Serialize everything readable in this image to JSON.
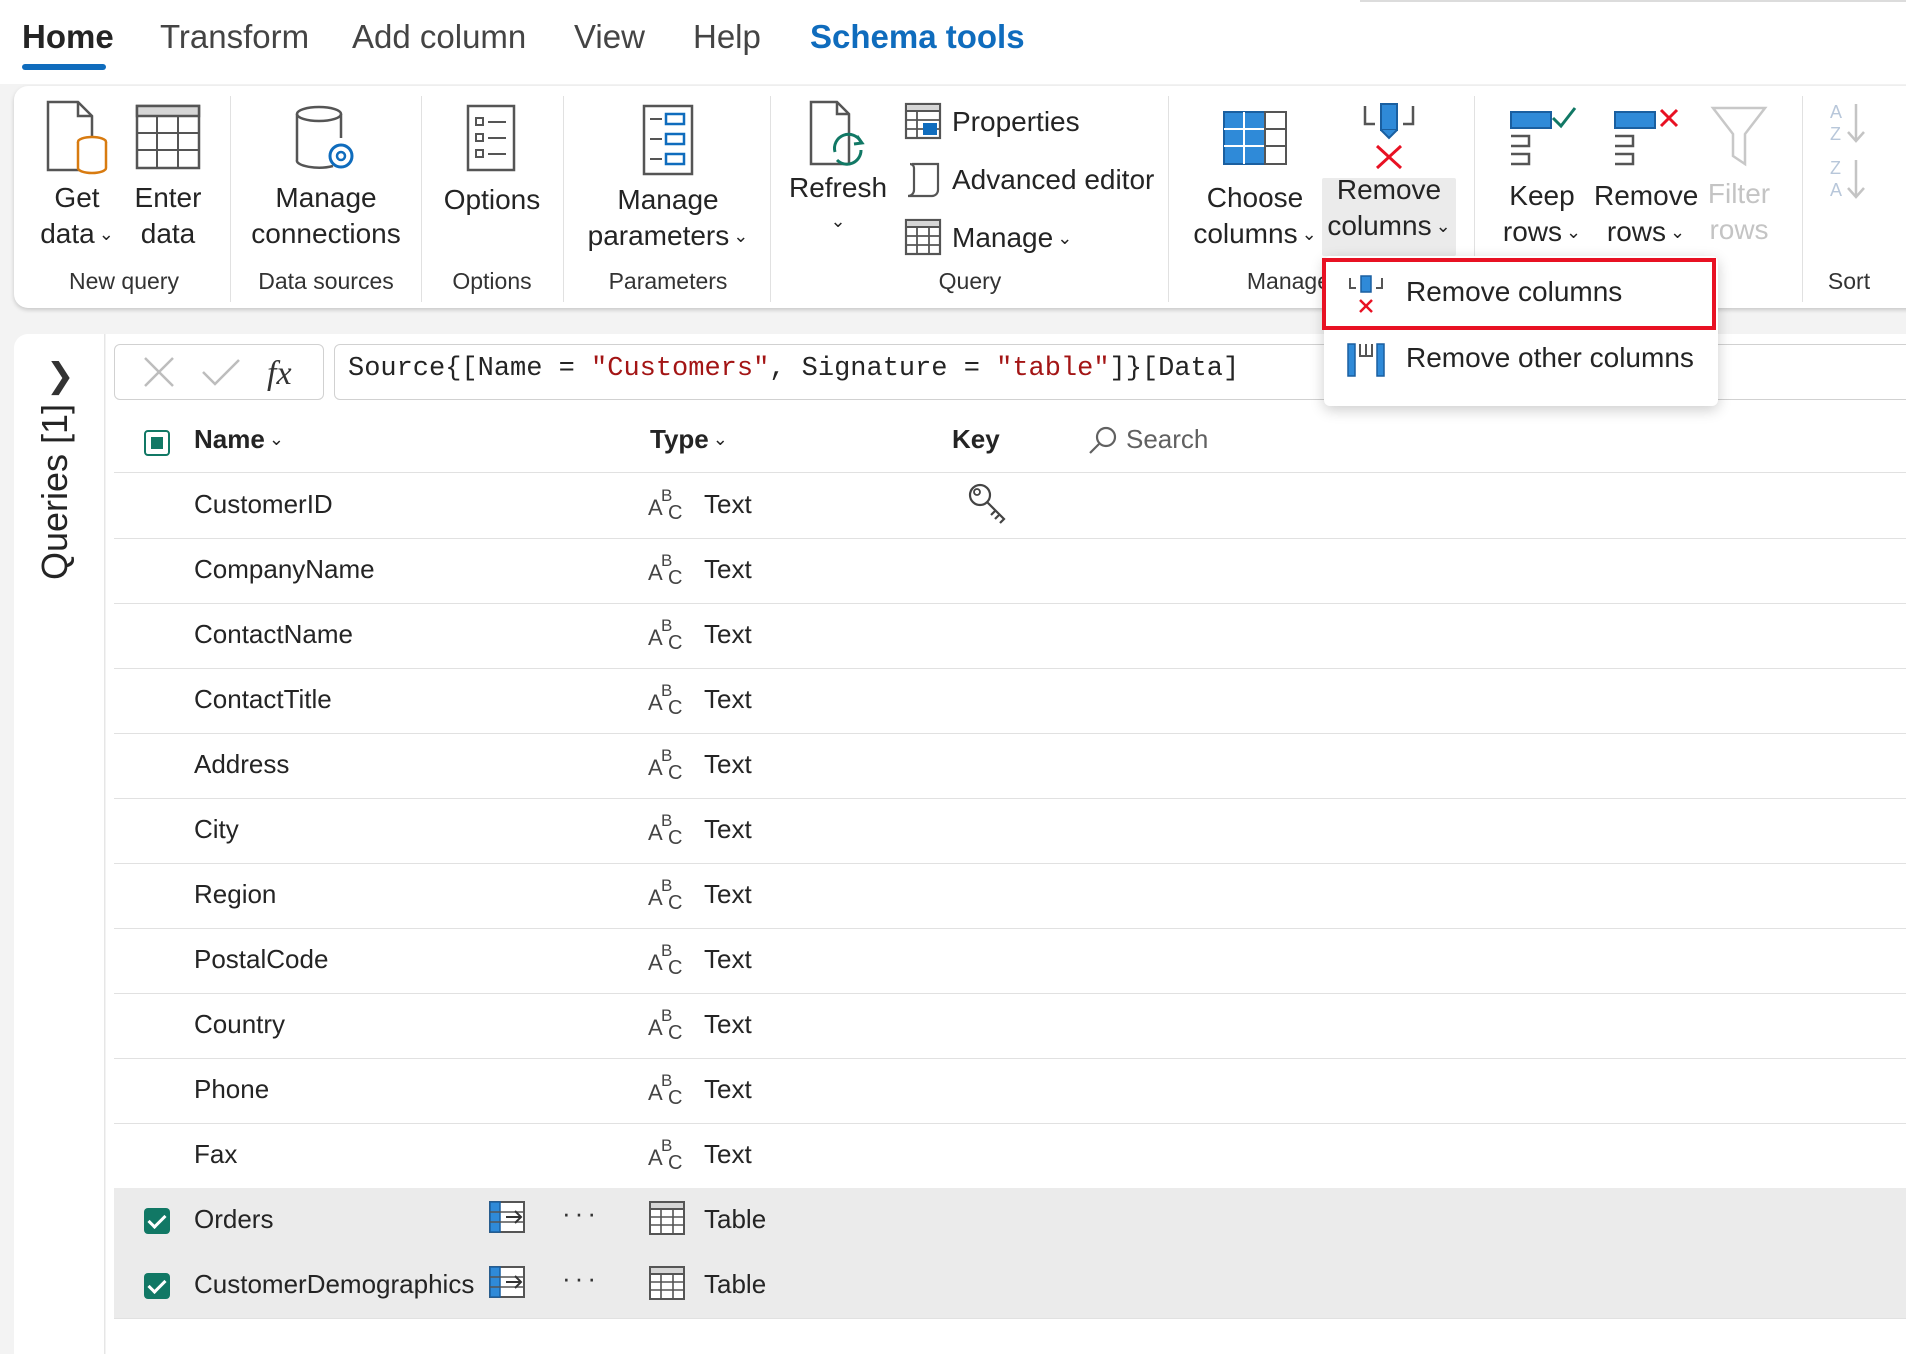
{
  "tabs": {
    "home": "Home",
    "transform": "Transform",
    "add_column": "Add column",
    "view": "View",
    "help": "Help",
    "schema_tools": "Schema tools"
  },
  "ribbon": {
    "get_data": [
      "Get",
      "data"
    ],
    "enter_data": [
      "Enter",
      "data"
    ],
    "group_new_query": "New query",
    "manage_connections": [
      "Manage",
      "connections"
    ],
    "group_data_sources": "Data sources",
    "options": "Options",
    "group_options": "Options",
    "manage_parameters": [
      "Manage",
      "parameters"
    ],
    "group_parameters": "Parameters",
    "refresh": "Refresh",
    "properties": "Properties",
    "advanced_editor": "Advanced editor",
    "manage": "Manage",
    "group_query": "Query",
    "choose_columns": [
      "Choose",
      "columns"
    ],
    "remove_columns": [
      "Remove",
      "columns"
    ],
    "group_manage": "Manage",
    "keep_rows": [
      "Keep",
      "rows"
    ],
    "remove_rows": [
      "Remove",
      "rows"
    ],
    "filter_rows": [
      "Filter",
      "rows"
    ],
    "group_sort": "Sort"
  },
  "dropdown": {
    "remove_columns": "Remove columns",
    "remove_other_columns": "Remove other columns"
  },
  "left_pane": {
    "queries_label": "Queries [1]"
  },
  "formula": {
    "part1": "Source{[Name = ",
    "str1": "\"Customers\"",
    "part2": ", Signature = ",
    "str2": "\"table\"",
    "part3": "]}[Data]"
  },
  "table": {
    "headers": {
      "name": "Name",
      "type": "Type",
      "key": "Key"
    },
    "search_placeholder": "Search",
    "rows": [
      {
        "name": "CustomerID",
        "type": "Text"
      },
      {
        "name": "CompanyName",
        "type": "Text"
      },
      {
        "name": "ContactName",
        "type": "Text"
      },
      {
        "name": "ContactTitle",
        "type": "Text"
      },
      {
        "name": "Address",
        "type": "Text"
      },
      {
        "name": "City",
        "type": "Text"
      },
      {
        "name": "Region",
        "type": "Text"
      },
      {
        "name": "PostalCode",
        "type": "Text"
      },
      {
        "name": "Country",
        "type": "Text"
      },
      {
        "name": "Phone",
        "type": "Text"
      },
      {
        "name": "Fax",
        "type": "Text"
      },
      {
        "name": "Orders",
        "type": "Table",
        "selected": true
      },
      {
        "name": "CustomerDemographics",
        "type": "Table",
        "selected": true
      }
    ]
  },
  "colors": {
    "accent": "#0f6cbd",
    "checkbox": "#117865",
    "highlight": "#e81123"
  }
}
